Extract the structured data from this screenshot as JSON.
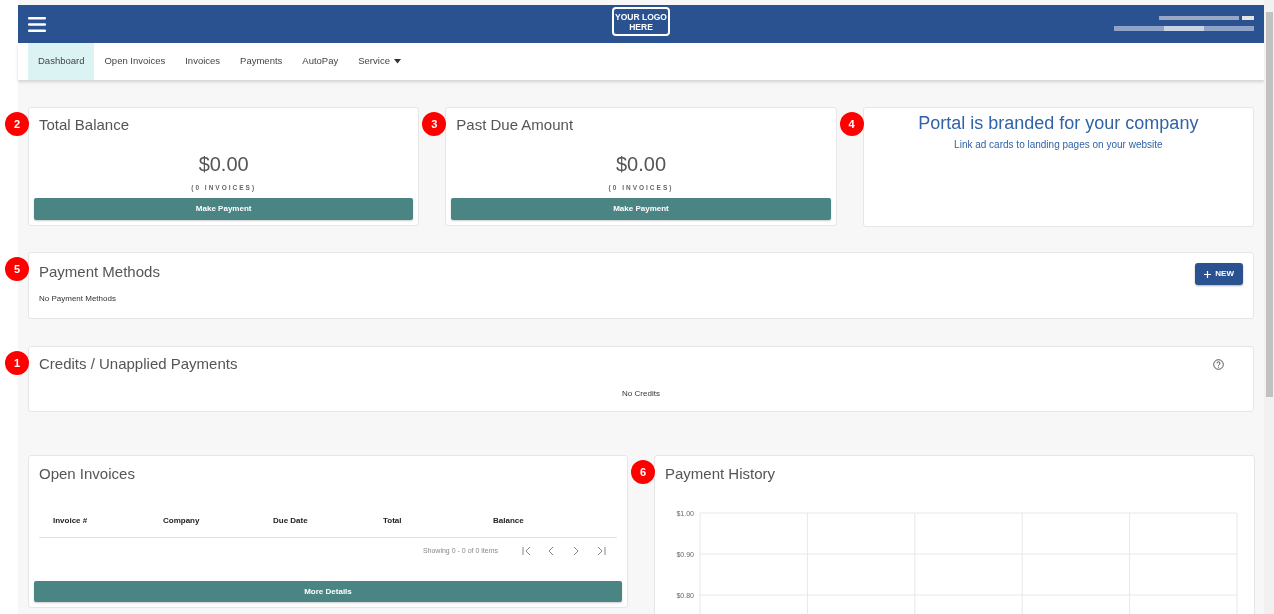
{
  "header": {
    "logo_text": "YOUR LOGO HERE"
  },
  "nav": [
    {
      "label": "Dashboard",
      "selected": true,
      "dropdown": false
    },
    {
      "label": "Open Invoices",
      "selected": false,
      "dropdown": false
    },
    {
      "label": "Invoices",
      "selected": false,
      "dropdown": false
    },
    {
      "label": "Payments",
      "selected": false,
      "dropdown": false
    },
    {
      "label": "AutoPay",
      "selected": false,
      "dropdown": false
    },
    {
      "label": "Service",
      "selected": false,
      "dropdown": true
    }
  ],
  "summary_cards": [
    {
      "marker": "2",
      "title": "Total Balance",
      "amount": "$0.00",
      "count": "(0 INVOICES)",
      "button": "Make Payment"
    },
    {
      "marker": "3",
      "title": "Past Due Amount",
      "amount": "$0.00",
      "count": "(0 INVOICES)",
      "button": "Make Payment"
    }
  ],
  "ad_card": {
    "marker": "4",
    "headline": "Portal is branded for your company",
    "subline": "Link ad cards to landing pages on your website"
  },
  "payment_methods": {
    "marker": "5",
    "title": "Payment Methods",
    "button": "NEW",
    "empty_text": "No Payment Methods"
  },
  "credits": {
    "marker": "1",
    "title": "Credits / Unapplied Payments",
    "empty_text": "No Credits"
  },
  "open_invoices": {
    "title": "Open Invoices",
    "columns": [
      "Invoice #",
      "Company",
      "Due Date",
      "Total",
      "Balance"
    ],
    "pager_text": "Showing 0 - 0 of 0 items",
    "button": "More Details"
  },
  "payment_history": {
    "marker": "6",
    "title": "Payment History",
    "y_axis_labels": [
      "$1.00",
      "$0.90",
      "$0.80"
    ]
  }
}
